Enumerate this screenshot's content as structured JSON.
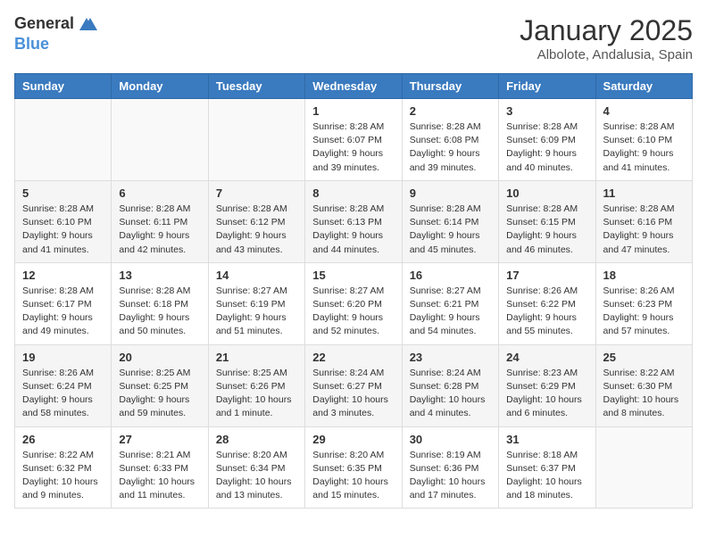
{
  "header": {
    "logo_general": "General",
    "logo_blue": "Blue",
    "month_title": "January 2025",
    "location": "Albolote, Andalusia, Spain"
  },
  "days_of_week": [
    "Sunday",
    "Monday",
    "Tuesday",
    "Wednesday",
    "Thursday",
    "Friday",
    "Saturday"
  ],
  "weeks": [
    [
      {
        "day": "",
        "info": ""
      },
      {
        "day": "",
        "info": ""
      },
      {
        "day": "",
        "info": ""
      },
      {
        "day": "1",
        "info": "Sunrise: 8:28 AM\nSunset: 6:07 PM\nDaylight: 9 hours and 39 minutes."
      },
      {
        "day": "2",
        "info": "Sunrise: 8:28 AM\nSunset: 6:08 PM\nDaylight: 9 hours and 39 minutes."
      },
      {
        "day": "3",
        "info": "Sunrise: 8:28 AM\nSunset: 6:09 PM\nDaylight: 9 hours and 40 minutes."
      },
      {
        "day": "4",
        "info": "Sunrise: 8:28 AM\nSunset: 6:10 PM\nDaylight: 9 hours and 41 minutes."
      }
    ],
    [
      {
        "day": "5",
        "info": "Sunrise: 8:28 AM\nSunset: 6:10 PM\nDaylight: 9 hours and 41 minutes."
      },
      {
        "day": "6",
        "info": "Sunrise: 8:28 AM\nSunset: 6:11 PM\nDaylight: 9 hours and 42 minutes."
      },
      {
        "day": "7",
        "info": "Sunrise: 8:28 AM\nSunset: 6:12 PM\nDaylight: 9 hours and 43 minutes."
      },
      {
        "day": "8",
        "info": "Sunrise: 8:28 AM\nSunset: 6:13 PM\nDaylight: 9 hours and 44 minutes."
      },
      {
        "day": "9",
        "info": "Sunrise: 8:28 AM\nSunset: 6:14 PM\nDaylight: 9 hours and 45 minutes."
      },
      {
        "day": "10",
        "info": "Sunrise: 8:28 AM\nSunset: 6:15 PM\nDaylight: 9 hours and 46 minutes."
      },
      {
        "day": "11",
        "info": "Sunrise: 8:28 AM\nSunset: 6:16 PM\nDaylight: 9 hours and 47 minutes."
      }
    ],
    [
      {
        "day": "12",
        "info": "Sunrise: 8:28 AM\nSunset: 6:17 PM\nDaylight: 9 hours and 49 minutes."
      },
      {
        "day": "13",
        "info": "Sunrise: 8:28 AM\nSunset: 6:18 PM\nDaylight: 9 hours and 50 minutes."
      },
      {
        "day": "14",
        "info": "Sunrise: 8:27 AM\nSunset: 6:19 PM\nDaylight: 9 hours and 51 minutes."
      },
      {
        "day": "15",
        "info": "Sunrise: 8:27 AM\nSunset: 6:20 PM\nDaylight: 9 hours and 52 minutes."
      },
      {
        "day": "16",
        "info": "Sunrise: 8:27 AM\nSunset: 6:21 PM\nDaylight: 9 hours and 54 minutes."
      },
      {
        "day": "17",
        "info": "Sunrise: 8:26 AM\nSunset: 6:22 PM\nDaylight: 9 hours and 55 minutes."
      },
      {
        "day": "18",
        "info": "Sunrise: 8:26 AM\nSunset: 6:23 PM\nDaylight: 9 hours and 57 minutes."
      }
    ],
    [
      {
        "day": "19",
        "info": "Sunrise: 8:26 AM\nSunset: 6:24 PM\nDaylight: 9 hours and 58 minutes."
      },
      {
        "day": "20",
        "info": "Sunrise: 8:25 AM\nSunset: 6:25 PM\nDaylight: 9 hours and 59 minutes."
      },
      {
        "day": "21",
        "info": "Sunrise: 8:25 AM\nSunset: 6:26 PM\nDaylight: 10 hours and 1 minute."
      },
      {
        "day": "22",
        "info": "Sunrise: 8:24 AM\nSunset: 6:27 PM\nDaylight: 10 hours and 3 minutes."
      },
      {
        "day": "23",
        "info": "Sunrise: 8:24 AM\nSunset: 6:28 PM\nDaylight: 10 hours and 4 minutes."
      },
      {
        "day": "24",
        "info": "Sunrise: 8:23 AM\nSunset: 6:29 PM\nDaylight: 10 hours and 6 minutes."
      },
      {
        "day": "25",
        "info": "Sunrise: 8:22 AM\nSunset: 6:30 PM\nDaylight: 10 hours and 8 minutes."
      }
    ],
    [
      {
        "day": "26",
        "info": "Sunrise: 8:22 AM\nSunset: 6:32 PM\nDaylight: 10 hours and 9 minutes."
      },
      {
        "day": "27",
        "info": "Sunrise: 8:21 AM\nSunset: 6:33 PM\nDaylight: 10 hours and 11 minutes."
      },
      {
        "day": "28",
        "info": "Sunrise: 8:20 AM\nSunset: 6:34 PM\nDaylight: 10 hours and 13 minutes."
      },
      {
        "day": "29",
        "info": "Sunrise: 8:20 AM\nSunset: 6:35 PM\nDaylight: 10 hours and 15 minutes."
      },
      {
        "day": "30",
        "info": "Sunrise: 8:19 AM\nSunset: 6:36 PM\nDaylight: 10 hours and 17 minutes."
      },
      {
        "day": "31",
        "info": "Sunrise: 8:18 AM\nSunset: 6:37 PM\nDaylight: 10 hours and 18 minutes."
      },
      {
        "day": "",
        "info": ""
      }
    ]
  ]
}
